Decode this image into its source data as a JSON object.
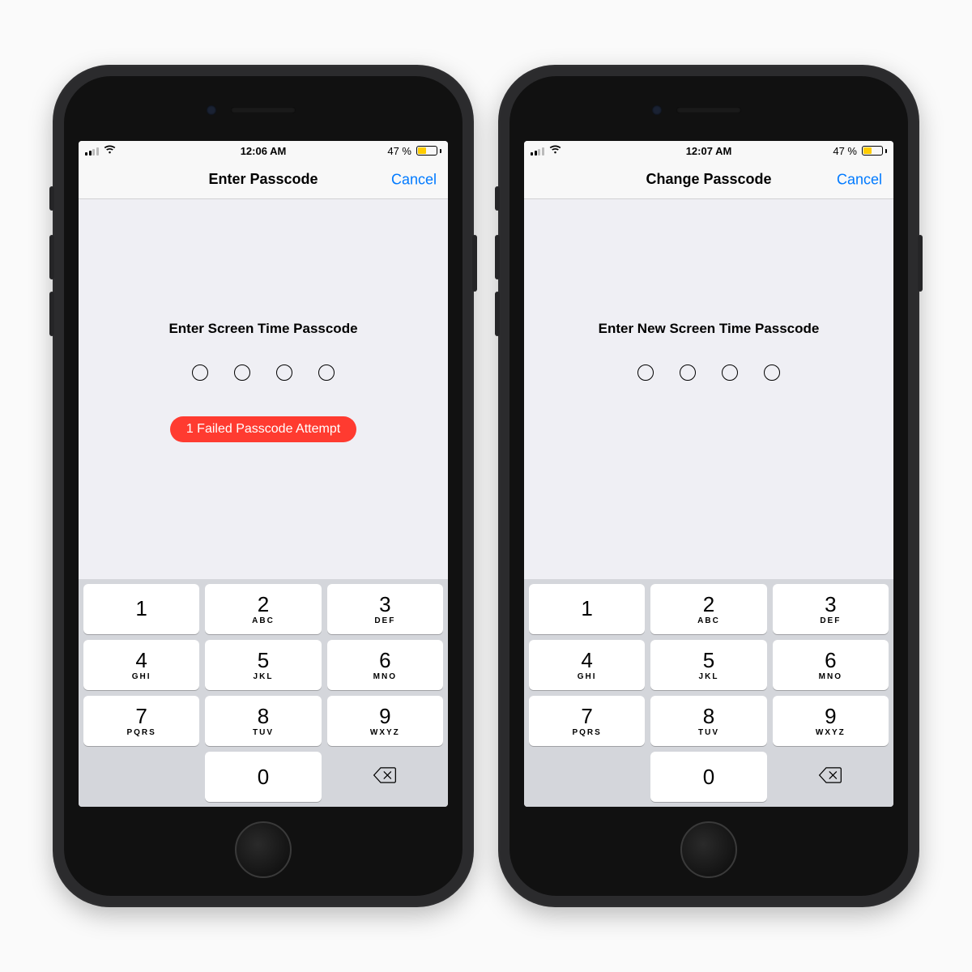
{
  "colors": {
    "accent": "#007aff",
    "danger": "#ff3b30",
    "batteryLow": "#ffcc00"
  },
  "keypad": {
    "keys": [
      {
        "digit": "1",
        "letters": ""
      },
      {
        "digit": "2",
        "letters": "ABC"
      },
      {
        "digit": "3",
        "letters": "DEF"
      },
      {
        "digit": "4",
        "letters": "GHI"
      },
      {
        "digit": "5",
        "letters": "JKL"
      },
      {
        "digit": "6",
        "letters": "MNO"
      },
      {
        "digit": "7",
        "letters": "PQRS"
      },
      {
        "digit": "8",
        "letters": "TUV"
      },
      {
        "digit": "9",
        "letters": "WXYZ"
      },
      {
        "digit": "0",
        "letters": ""
      }
    ]
  },
  "phones": [
    {
      "status": {
        "time": "12:06 AM",
        "batteryPct": "47 %",
        "batteryFill": 47
      },
      "nav": {
        "title": "Enter Passcode",
        "cancel": "Cancel"
      },
      "prompt": "Enter Screen Time Passcode",
      "failedAttempt": "1 Failed Passcode Attempt",
      "showFailed": true
    },
    {
      "status": {
        "time": "12:07 AM",
        "batteryPct": "47 %",
        "batteryFill": 47
      },
      "nav": {
        "title": "Change Passcode",
        "cancel": "Cancel"
      },
      "prompt": "Enter New Screen Time Passcode",
      "failedAttempt": "",
      "showFailed": false
    }
  ]
}
